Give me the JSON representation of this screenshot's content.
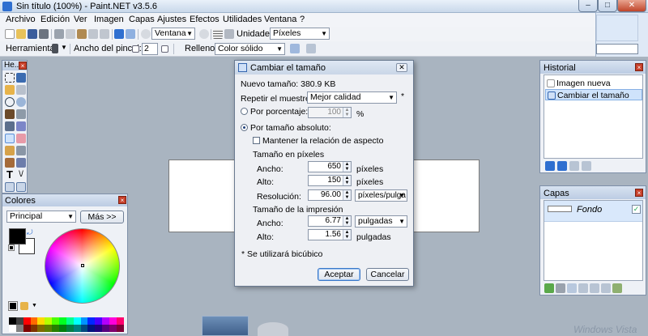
{
  "window": {
    "title": "Sin título (100%) - Paint.NET v3.5.6",
    "min": "–",
    "max": "□",
    "close": "✕"
  },
  "menu": [
    "Archivo",
    "Edición",
    "Ver",
    "Imagen",
    "Capas",
    "Ajustes",
    "Efectos",
    "Utilidades",
    "Ventana",
    "?"
  ],
  "toolbar": {
    "view_combo": "Ventana",
    "units_label": "Unidades:",
    "units_value": "Píxeles",
    "tool_label": "Herramienta:",
    "brush_width_label": "Ancho del pincel:",
    "brush_width_value": "2",
    "fill_label": "Relleno:",
    "fill_value": "Color sólido"
  },
  "tools_panel": {
    "title": "He..."
  },
  "colors_panel": {
    "title": "Colores",
    "mode": "Principal",
    "more_button": "Más >>",
    "primary": "#000000",
    "secondary": "#ffffff",
    "palette": [
      "#000000",
      "#404040",
      "#ff0000",
      "#ff6a00",
      "#ffd800",
      "#b6ff00",
      "#4cff00",
      "#00ff21",
      "#00ff90",
      "#00ffff",
      "#0094ff",
      "#0026ff",
      "#4800ff",
      "#b200ff",
      "#ff00dc",
      "#ff006e",
      "#ffffff",
      "#808080",
      "#7f0000",
      "#7f3300",
      "#7f6a00",
      "#5b7f00",
      "#267f00",
      "#007f0e",
      "#007f46",
      "#007f7f",
      "#004a7f",
      "#00137f",
      "#21007f",
      "#57007f",
      "#7f006e",
      "#7f0037"
    ]
  },
  "history_panel": {
    "title": "Historial",
    "items": [
      "Imagen nueva",
      "Cambiar el tamaño"
    ]
  },
  "layers_panel": {
    "title": "Capas",
    "layer_name": "Fondo",
    "visible_mark": "✓"
  },
  "dialog": {
    "title": "Cambiar el tamaño",
    "close": "✕",
    "new_size": "Nuevo tamaño: 380.9 KB",
    "resample_label": "Repetir el muestreo:",
    "resample_value": "Mejor calidad",
    "resample_star": "*",
    "by_percentage": "Por porcentaje:",
    "percentage_value": "100",
    "percentage_unit": "%",
    "by_absolute": "Por tamaño absoluto:",
    "keep_aspect": "Mantener la relación de aspecto",
    "pixel_size_header": "Tamaño en píxeles",
    "width_label": "Ancho:",
    "width_px": "650",
    "width_px_unit": "píxeles",
    "height_label": "Alto:",
    "height_px": "150",
    "height_px_unit": "píxeles",
    "resolution_label": "Resolución:",
    "resolution_value": "96.00",
    "resolution_unit": "píxeles/pulga",
    "print_size_header": "Tamaño de la impresión",
    "print_width_label": "Ancho:",
    "print_width": "6.77",
    "print_width_unit": "pulgadas",
    "print_height_label": "Alto:",
    "print_height": "1.56",
    "print_height_unit": "pulgadas",
    "bicubic_note": "* Se utilizará bicúbico",
    "ok": "Aceptar",
    "cancel": "Cancelar"
  },
  "watermark": "Windows Vista"
}
